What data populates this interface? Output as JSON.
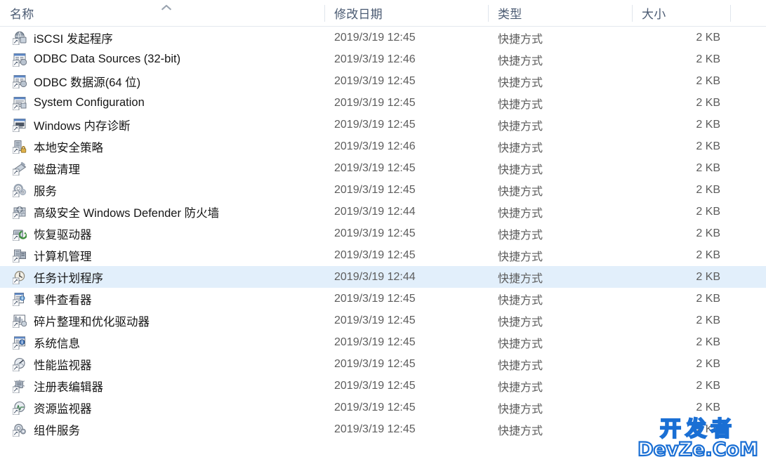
{
  "window": {
    "view_mode": "details",
    "accent_selection_color": "#e2effb",
    "header_text_color": "#4a5a72",
    "row_text_color": "#161616",
    "secondary_text_color": "#5d5d5d"
  },
  "columns": {
    "name": {
      "label": "名称",
      "sorted": true,
      "sort_direction": "ascending",
      "sort_icon": "chevron-up-icon"
    },
    "date_modified": {
      "label": "修改日期"
    },
    "type": {
      "label": "类型"
    },
    "size": {
      "label": "大小"
    }
  },
  "files": [
    {
      "name": "iSCSI 发起程序",
      "date": "2019/3/19 12:45",
      "type": "快捷方式",
      "size": "2 KB",
      "icon": "iscsi-initiator-icon",
      "selected": false
    },
    {
      "name": "ODBC Data Sources (32-bit)",
      "date": "2019/3/19 12:46",
      "type": "快捷方式",
      "size": "2 KB",
      "icon": "odbc-icon",
      "selected": false
    },
    {
      "name": "ODBC 数据源(64 位)",
      "date": "2019/3/19 12:45",
      "type": "快捷方式",
      "size": "2 KB",
      "icon": "odbc-icon",
      "selected": false
    },
    {
      "name": "System Configuration",
      "date": "2019/3/19 12:45",
      "type": "快捷方式",
      "size": "2 KB",
      "icon": "system-configuration-icon",
      "selected": false
    },
    {
      "name": "Windows 内存诊断",
      "date": "2019/3/19 12:45",
      "type": "快捷方式",
      "size": "2 KB",
      "icon": "memory-diagnostic-icon",
      "selected": false
    },
    {
      "name": "本地安全策略",
      "date": "2019/3/19 12:46",
      "type": "快捷方式",
      "size": "2 KB",
      "icon": "local-security-policy-icon",
      "selected": false
    },
    {
      "name": "磁盘清理",
      "date": "2019/3/19 12:45",
      "type": "快捷方式",
      "size": "2 KB",
      "icon": "disk-cleanup-icon",
      "selected": false
    },
    {
      "name": "服务",
      "date": "2019/3/19 12:45",
      "type": "快捷方式",
      "size": "2 KB",
      "icon": "services-icon",
      "selected": false
    },
    {
      "name": "高级安全 Windows Defender 防火墙",
      "date": "2019/3/19 12:44",
      "type": "快捷方式",
      "size": "2 KB",
      "icon": "firewall-icon",
      "selected": false
    },
    {
      "name": "恢复驱动器",
      "date": "2019/3/19 12:45",
      "type": "快捷方式",
      "size": "2 KB",
      "icon": "recovery-drive-icon",
      "selected": false
    },
    {
      "name": "计算机管理",
      "date": "2019/3/19 12:45",
      "type": "快捷方式",
      "size": "2 KB",
      "icon": "computer-management-icon",
      "selected": false
    },
    {
      "name": "任务计划程序",
      "date": "2019/3/19 12:44",
      "type": "快捷方式",
      "size": "2 KB",
      "icon": "task-scheduler-icon",
      "selected": true
    },
    {
      "name": "事件查看器",
      "date": "2019/3/19 12:45",
      "type": "快捷方式",
      "size": "2 KB",
      "icon": "event-viewer-icon",
      "selected": false
    },
    {
      "name": "碎片整理和优化驱动器",
      "date": "2019/3/19 12:45",
      "type": "快捷方式",
      "size": "2 KB",
      "icon": "defragment-icon",
      "selected": false
    },
    {
      "name": "系统信息",
      "date": "2019/3/19 12:45",
      "type": "快捷方式",
      "size": "2 KB",
      "icon": "system-information-icon",
      "selected": false
    },
    {
      "name": "性能监视器",
      "date": "2019/3/19 12:45",
      "type": "快捷方式",
      "size": "2 KB",
      "icon": "performance-monitor-icon",
      "selected": false
    },
    {
      "name": "注册表编辑器",
      "date": "2019/3/19 12:45",
      "type": "快捷方式",
      "size": "2 KB",
      "icon": "registry-editor-icon",
      "selected": false
    },
    {
      "name": "资源监视器",
      "date": "2019/3/19 12:45",
      "type": "快捷方式",
      "size": "2 KB",
      "icon": "resource-monitor-icon",
      "selected": false
    },
    {
      "name": "组件服务",
      "date": "2019/3/19 12:45",
      "type": "快捷方式",
      "size": "2 KB",
      "icon": "component-services-icon",
      "selected": false
    }
  ],
  "watermark": {
    "line1": "开发者",
    "line2": "DevZe.CoM",
    "color": "#1a6fd4"
  }
}
